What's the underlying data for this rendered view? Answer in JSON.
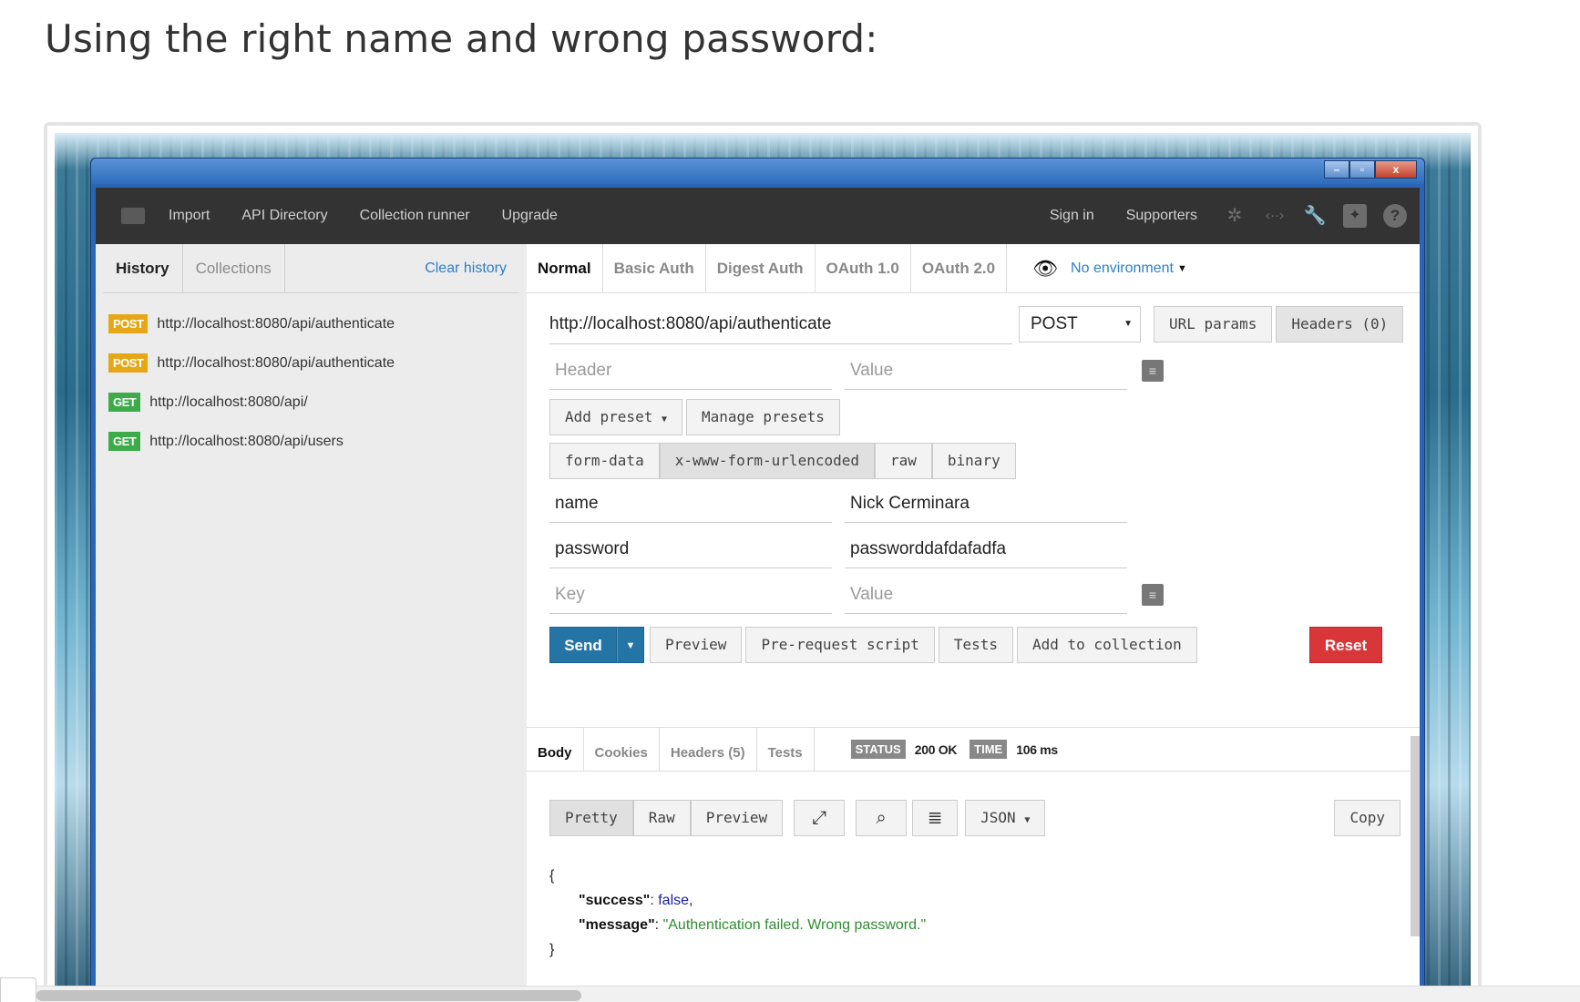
{
  "article": {
    "heading": "Using the right name and wrong password:"
  },
  "window": {
    "controls": {
      "minimize": "–",
      "maximize": "▫",
      "close": "x"
    }
  },
  "topbar": {
    "items": [
      "Import",
      "API Directory",
      "Collection runner",
      "Upgrade"
    ],
    "sign_in": "Sign in",
    "supporters": "Supporters"
  },
  "sidebar": {
    "tabs": {
      "history": "History",
      "collections": "Collections",
      "clear": "Clear history"
    },
    "history": [
      {
        "method": "POST",
        "url": "http://localhost:8080/api/authenticate"
      },
      {
        "method": "POST",
        "url": "http://localhost:8080/api/authenticate"
      },
      {
        "method": "GET",
        "url": "http://localhost:8080/api/"
      },
      {
        "method": "GET",
        "url": "http://localhost:8080/api/users"
      }
    ]
  },
  "request": {
    "auth_tabs": [
      "Normal",
      "Basic Auth",
      "Digest Auth",
      "OAuth 1.0",
      "OAuth 2.0"
    ],
    "environment": "No environment",
    "url": "http://localhost:8080/api/authenticate",
    "method": "POST",
    "url_params_label": "URL params",
    "headers_label": "Headers (0)",
    "header_placeholder": "Header",
    "value_placeholder": "Value",
    "add_preset": "Add preset",
    "manage_presets": "Manage presets",
    "body_types": [
      "form-data",
      "x-www-form-urlencoded",
      "raw",
      "binary"
    ],
    "params": [
      {
        "key": "name",
        "value": "Nick Cerminara"
      },
      {
        "key": "password",
        "value": "passworddafdafadfa"
      }
    ],
    "key_placeholder": "Key",
    "send": "Send",
    "preview": "Preview",
    "prerequest": "Pre-request script",
    "tests": "Tests",
    "add_to_collection": "Add to collection",
    "reset": "Reset"
  },
  "response": {
    "tabs": [
      "Body",
      "Cookies",
      "Headers (5)",
      "Tests"
    ],
    "status_label": "STATUS",
    "status_value": "200 OK",
    "time_label": "TIME",
    "time_value": "106 ms",
    "views": [
      "Pretty",
      "Raw",
      "Preview"
    ],
    "format": "JSON",
    "copy": "Copy",
    "json": {
      "open": "{",
      "success_key": "\"success\"",
      "success_val": "false",
      "message_key": "\"message\"",
      "message_val": "\"Authentication failed. Wrong password.\"",
      "close": "}"
    }
  }
}
